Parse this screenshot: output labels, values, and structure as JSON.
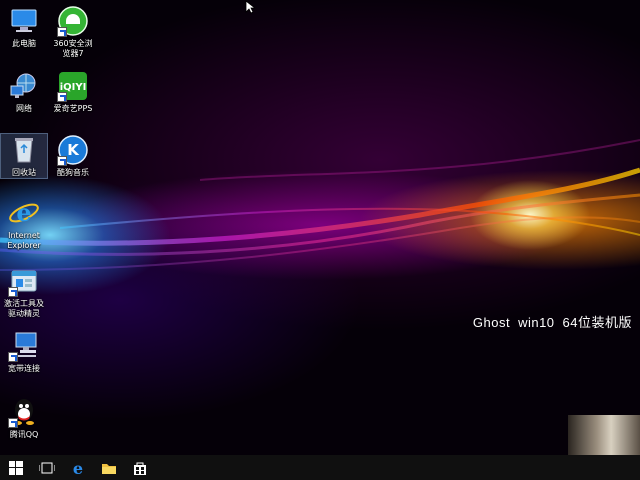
{
  "desktop": {
    "icons": [
      {
        "label": "此电脑"
      },
      {
        "label": "360安全浏览器7"
      },
      {
        "label": "网络"
      },
      {
        "label": "爱奇艺PPS"
      },
      {
        "label": "回收站"
      },
      {
        "label": "酷狗音乐"
      },
      {
        "label": "Internet Explorer"
      },
      {
        "label": "激活工具及驱动精灵"
      },
      {
        "label": "宽带连接"
      },
      {
        "label": "腾讯QQ"
      }
    ],
    "watermark": {
      "brand": "Ghost",
      "version": "win10",
      "edition": "64位装机版"
    }
  },
  "taskbar": {
    "buttons": [
      {
        "icon": "windows-start-icon"
      },
      {
        "icon": "task-view-icon"
      },
      {
        "icon": "edge-browser-icon"
      },
      {
        "icon": "file-explorer-icon"
      },
      {
        "icon": "store-icon"
      }
    ]
  },
  "colors": {
    "taskbar": "#101010",
    "accent_blue": "#1a7ad8",
    "accent_green": "#2aa52a"
  }
}
